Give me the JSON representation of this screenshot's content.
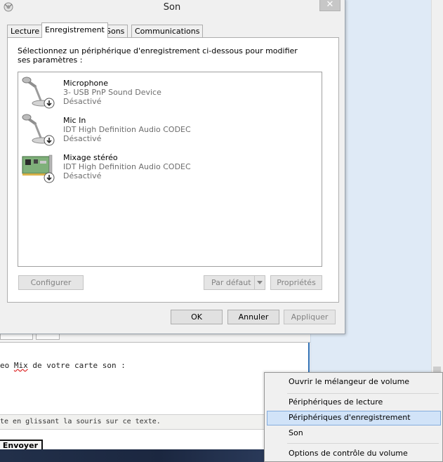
{
  "dialog": {
    "title": "Son",
    "close_glyph": "✕",
    "tabs": [
      {
        "label": "Lecture",
        "active": false
      },
      {
        "label": "Enregistrement",
        "active": true
      },
      {
        "label": "Sons",
        "active": false
      },
      {
        "label": "Communications",
        "active": false
      }
    ],
    "instruction": "Sélectionnez un périphérique d'enregistrement ci-dessous pour modifier ses paramètres :",
    "devices": [
      {
        "name": "Microphone",
        "description": "3- USB PnP Sound Device",
        "status": "Désactivé",
        "icon": "microphone-icon"
      },
      {
        "name": "Mic In",
        "description": "IDT High Definition Audio CODEC",
        "status": "Désactivé",
        "icon": "microphone-icon"
      },
      {
        "name": "Mixage stéréo",
        "description": "IDT High Definition Audio CODEC",
        "status": "Désactivé",
        "icon": "sound-card-icon"
      }
    ],
    "buttons": {
      "configure": "Configurer",
      "set_default": "Par défaut",
      "properties": "Propriétés",
      "ok": "OK",
      "cancel": "Annuler",
      "apply": "Appliquer"
    }
  },
  "background": {
    "editor_text": "eo Mix de votre carte son :",
    "editor_text_underlined": "Mix",
    "hint_text": "te en glissant la souris sur ce texte.",
    "send_button": "Envoyer"
  },
  "context_menu": {
    "items": [
      {
        "label": "Ouvrir le mélangeur de volume",
        "highlighted": false
      },
      {
        "label": "Périphériques de lecture",
        "highlighted": false
      },
      {
        "label": "Périphériques d'enregistrement",
        "highlighted": true
      },
      {
        "label": "Son",
        "highlighted": false
      },
      {
        "label": "Options de contrôle du volume",
        "highlighted": false
      }
    ]
  },
  "colors": {
    "menu_highlight": "#d1e3f8",
    "menu_highlight_border": "#84acdd",
    "dialog_background": "#f0f0f0",
    "disabled_text": "#838383"
  }
}
